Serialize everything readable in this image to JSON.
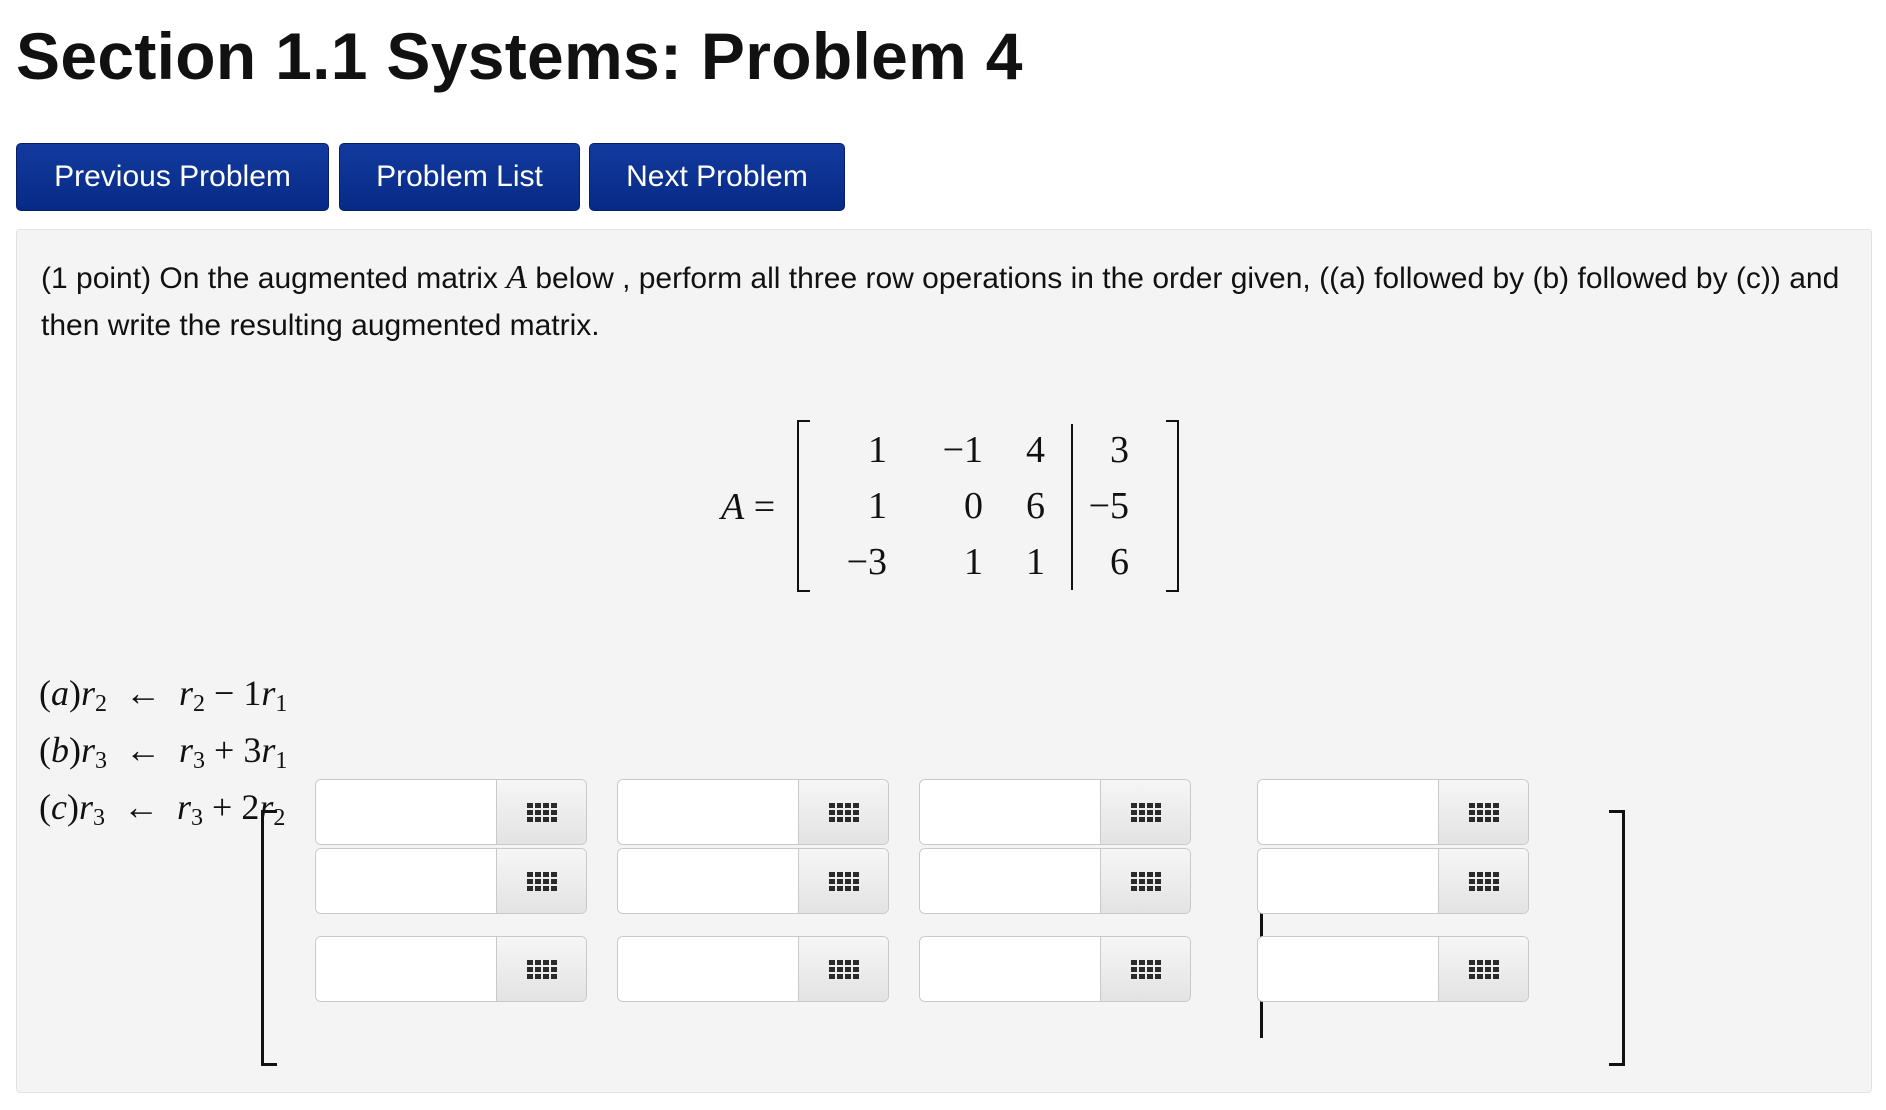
{
  "page": {
    "title": "Section 1.1 Systems: Problem 4"
  },
  "nav": {
    "previous": "Previous Problem",
    "list": "Problem List",
    "next": "Next Problem"
  },
  "problem": {
    "statement_before": "(1 point) On the augmented matrix ",
    "matrix_name": "A",
    "statement_after": " below , perform all three row operations in the order given, ((a) followed by (b) followed by (c)) and then write the resulting augmented matrix.",
    "matrix_label": "A =",
    "matrix": [
      [
        "1",
        "−1",
        "4",
        "3"
      ],
      [
        "1",
        "0",
        "6",
        "−5"
      ],
      [
        "−3",
        "1",
        "1",
        "6"
      ]
    ],
    "operations": [
      {
        "label": "(a)",
        "target": "r",
        "target_idx": "2",
        "arrow": "←",
        "lhs": "r",
        "lhs_idx": "2",
        "op": "−",
        "coef": "1",
        "src": "r",
        "src_idx": "1"
      },
      {
        "label": "(b)",
        "target": "r",
        "target_idx": "3",
        "arrow": "←",
        "lhs": "r",
        "lhs_idx": "3",
        "op": "+",
        "coef": "3",
        "src": "r",
        "src_idx": "1"
      },
      {
        "label": "(c)",
        "target": "r",
        "target_idx": "3",
        "arrow": "←",
        "lhs": "r",
        "lhs_idx": "3",
        "op": "+",
        "coef": "2",
        "src": "r",
        "src_idx": "2"
      }
    ]
  },
  "answer": {
    "rows": 3,
    "cols": 4,
    "values": [
      [
        "",
        "",
        "",
        ""
      ],
      [
        "",
        "",
        "",
        ""
      ],
      [
        "",
        "",
        "",
        ""
      ]
    ],
    "picker_icon": "grid-icon"
  }
}
